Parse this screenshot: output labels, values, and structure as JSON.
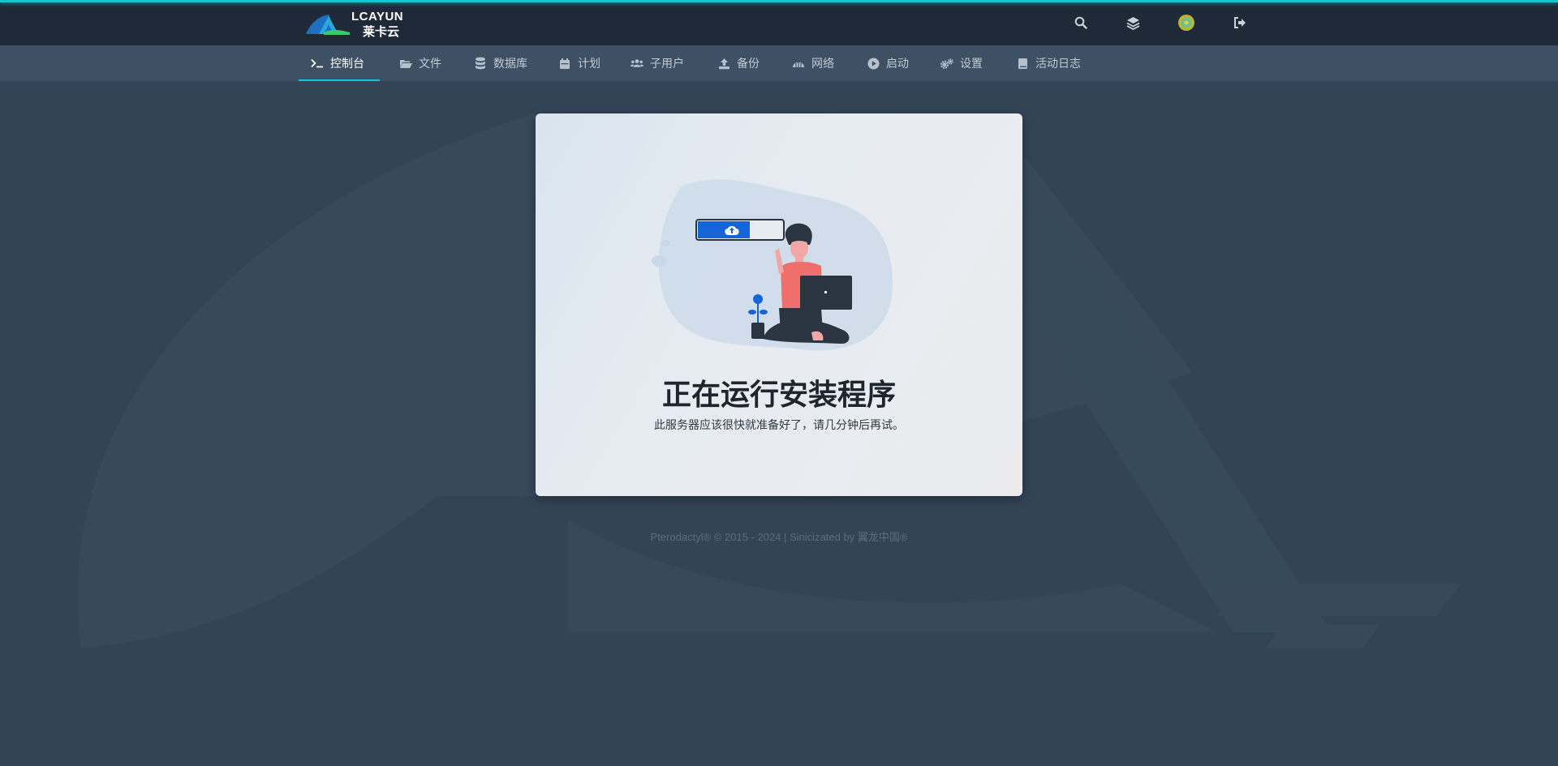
{
  "brand": {
    "logo_text": "LCAYUN",
    "logo_cn": "莱卡云"
  },
  "topbar": {
    "icons": [
      "search-icon",
      "layers-icon",
      "avatar",
      "sign-out-icon"
    ]
  },
  "nav": {
    "items": [
      {
        "label": "控制台",
        "icon": "terminal-icon",
        "active": true
      },
      {
        "label": "文件",
        "icon": "folder-open-icon"
      },
      {
        "label": "数据库",
        "icon": "database-icon"
      },
      {
        "label": "计划",
        "icon": "calendar-icon"
      },
      {
        "label": "子用户",
        "icon": "users-icon"
      },
      {
        "label": "备份",
        "icon": "upload-icon"
      },
      {
        "label": "网络",
        "icon": "network-icon"
      },
      {
        "label": "启动",
        "icon": "play-circle-icon"
      },
      {
        "label": "设置",
        "icon": "cogs-icon"
      },
      {
        "label": "活动日志",
        "icon": "book-icon"
      }
    ]
  },
  "main": {
    "title": "正在运行安装程序",
    "subtitle": "此服务器应该很快就准备好了，请几分钟后再试。"
  },
  "footer": {
    "text": "Pterodactyl® © 2015 - 2024 | Sinicizated by 翼龙中国®"
  },
  "colors": {
    "background": "#334456",
    "topbar": "#1f2a38",
    "navbar": "#3f5064",
    "accent": "#19c3d6",
    "progress_blue": "#1565d8"
  }
}
